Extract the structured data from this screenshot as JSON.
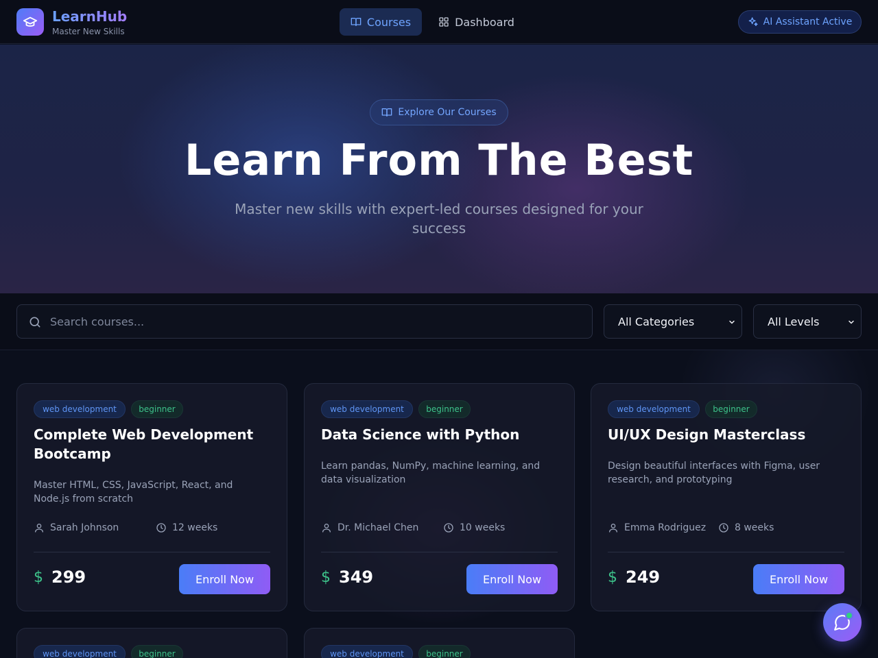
{
  "brand": {
    "name": "LearnHub",
    "tagline": "Master New Skills"
  },
  "nav": {
    "items": [
      {
        "label": "Courses",
        "icon": "book-open-icon",
        "active": true
      },
      {
        "label": "Dashboard",
        "icon": "grid-icon",
        "active": false
      }
    ],
    "ai_status": "AI Assistant Active"
  },
  "hero": {
    "badge": "Explore Our Courses",
    "title": "Learn From The Best",
    "subtitle": "Master new skills with expert-led courses designed for your success"
  },
  "filters": {
    "search_placeholder": "Search courses...",
    "category": "All Categories",
    "level": "All Levels"
  },
  "courses": [
    {
      "category": "web development",
      "level": "beginner",
      "title": "Complete Web Development Bootcamp",
      "description": "Master HTML, CSS, JavaScript, React, and Node.js from scratch",
      "instructor": "Sarah Johnson",
      "duration": "12 weeks",
      "currency": "$",
      "price": "299",
      "cta": "Enroll Now"
    },
    {
      "category": "web development",
      "level": "beginner",
      "title": "Data Science with Python",
      "description": "Learn pandas, NumPy, machine learning, and data visualization",
      "instructor": "Dr. Michael Chen",
      "duration": "10 weeks",
      "currency": "$",
      "price": "349",
      "cta": "Enroll Now"
    },
    {
      "category": "web development",
      "level": "beginner",
      "title": "UI/UX Design Masterclass",
      "description": "Design beautiful interfaces with Figma, user research, and prototyping",
      "instructor": "Emma Rodriguez",
      "duration": "8 weeks",
      "currency": "$",
      "price": "249",
      "cta": "Enroll Now"
    },
    {
      "category": "web development",
      "level": "beginner"
    },
    {
      "category": "web development",
      "level": "beginner"
    }
  ],
  "colors": {
    "accent_blue": "#4a7df7",
    "accent_purple": "#8f5cf5",
    "price_green": "#3dc28a",
    "background": "#0b0f1c"
  }
}
